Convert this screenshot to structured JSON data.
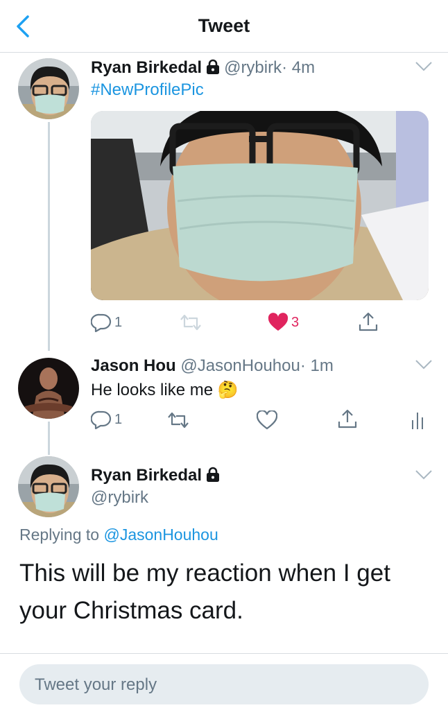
{
  "header": {
    "title": "Tweet"
  },
  "tweets": [
    {
      "name": "Ryan Birkedal",
      "handle": "@rybirk",
      "time": "· 4m",
      "hashtag": "#NewProfilePic",
      "actions": {
        "replies": "1",
        "likes": "3"
      }
    },
    {
      "name": "Jason Hou",
      "handle": "@JasonHouhou",
      "time": "· 1m",
      "text": "He looks like me",
      "emoji": "🤔",
      "actions": {
        "replies": "1"
      }
    }
  ],
  "main_tweet": {
    "name": "Ryan Birkedal",
    "handle": "@rybirk",
    "replying_prefix": "Replying to",
    "replying_to": "@JasonHouhou",
    "text": "This will be my reaction when I get your Christmas card."
  },
  "reply_box": {
    "placeholder": "Tweet your reply"
  },
  "colors": {
    "link": "#1b95e0",
    "like": "#e0245e",
    "muted": "#657786"
  },
  "icons": [
    "back-chevron-icon",
    "lock-icon",
    "chevron-down-icon",
    "reply-icon",
    "retweet-icon",
    "heart-icon",
    "share-icon",
    "analytics-icon"
  ]
}
